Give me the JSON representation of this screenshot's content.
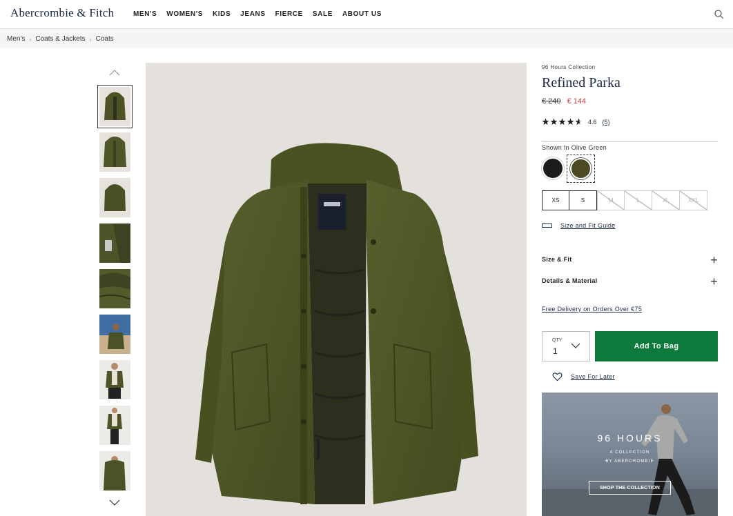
{
  "header": {
    "logo": "Abercrombie & Fitch",
    "nav": [
      "MEN'S",
      "WOMEN'S",
      "KIDS",
      "JEANS",
      "FIERCE",
      "SALE",
      "ABOUT US"
    ]
  },
  "breadcrumb": [
    "Men's",
    "Coats & Jackets",
    "Coats"
  ],
  "product": {
    "collection": "96 Hours Collection",
    "title": "Refined Parka",
    "price_original": "€ 240",
    "price_sale": "€ 144",
    "rating_value": "4.6",
    "rating_count": "(5)",
    "rating_stars": 4.6,
    "shown_in": "Shown In Olive Green",
    "colors": [
      {
        "name": "Black",
        "hex": "#1c1c1c",
        "selected": false
      },
      {
        "name": "Olive Green",
        "hex": "#4b4a22",
        "selected": true
      }
    ],
    "sizes": [
      {
        "label": "XS",
        "available": true
      },
      {
        "label": "S",
        "available": true
      },
      {
        "label": "M",
        "available": false
      },
      {
        "label": "L",
        "available": false
      },
      {
        "label": "XL",
        "available": false
      },
      {
        "label": "XXL",
        "available": false
      }
    ],
    "size_guide": "Size and Fit Guide",
    "accordions": [
      "Size & Fit",
      "Details & Material"
    ],
    "delivery": "Free Delivery on Orders Over €75",
    "qty_label": "QTY",
    "qty_value": "1",
    "add_to_bag": "Add To Bag",
    "save_for_later": "Save For Later"
  },
  "promo": {
    "headline": "96 HOURS",
    "line1": "A COLLECTION",
    "line2": "BY ABERCROMBIE",
    "button": "SHOP THE COLLECTION"
  },
  "colors": {
    "accent_green": "#0d7a3c",
    "sale_red": "#c23b3b",
    "navy": "#1a2a44"
  }
}
